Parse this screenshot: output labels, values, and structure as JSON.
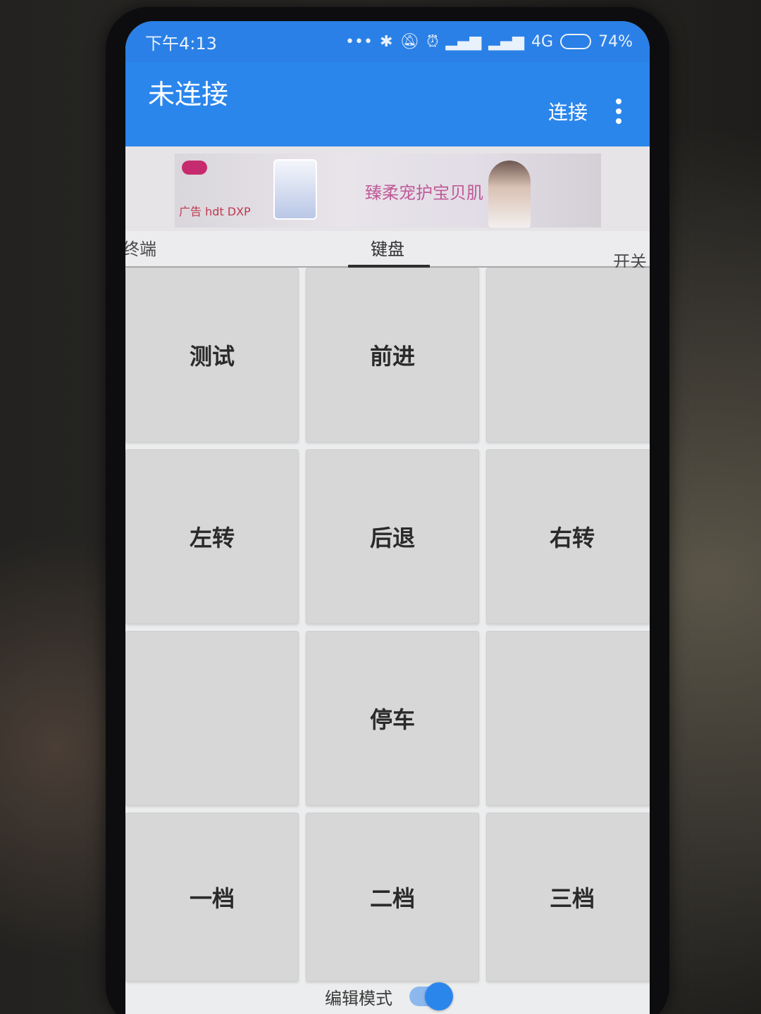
{
  "status_bar": {
    "time": "下午4:13",
    "network": "4G",
    "battery": "74%",
    "battery_level": 74,
    "icons": [
      "more-dots-icon",
      "bluetooth-icon",
      "mute-icon",
      "alarm-icon",
      "signal-icon",
      "signal-icon"
    ]
  },
  "app_bar": {
    "title": "未连接",
    "connect_label": "连接",
    "color": "#2b86ec"
  },
  "ad": {
    "slogan": "臻柔宠护宝贝肌",
    "brand_text": "广告 hdt DXP"
  },
  "tabs": {
    "items": [
      {
        "label": "终端",
        "selected": false
      },
      {
        "label": "键盘",
        "selected": true
      },
      {
        "label": "开关",
        "selected": false
      }
    ]
  },
  "keypad": {
    "keys": [
      {
        "label": "测试"
      },
      {
        "label": "前进"
      },
      {
        "label": ""
      },
      {
        "label": "左转"
      },
      {
        "label": "后退"
      },
      {
        "label": "右转"
      },
      {
        "label": ""
      },
      {
        "label": "停车"
      },
      {
        "label": ""
      },
      {
        "label": "一档"
      },
      {
        "label": "二档"
      },
      {
        "label": "三档"
      }
    ]
  },
  "footer": {
    "edit_mode_label": "编辑模式",
    "edit_mode_on": true
  }
}
